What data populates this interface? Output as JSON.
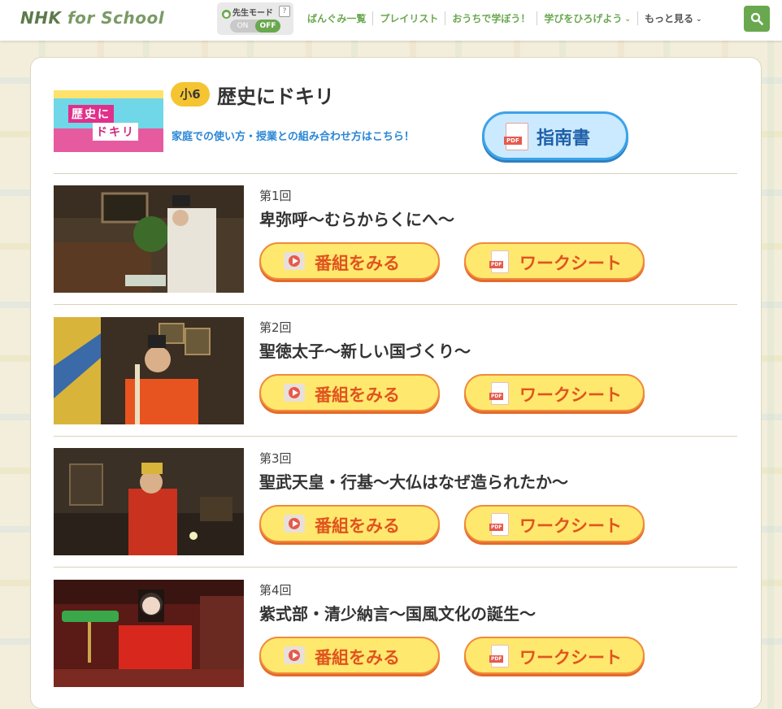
{
  "header": {
    "logo_nhk": "NHK",
    "logo_for": "for School",
    "teacher_mode": {
      "label": "先生モード",
      "help": "?",
      "on": "ON",
      "off": "OFF",
      "state": "OFF"
    },
    "nav": [
      {
        "label": "ばんぐみ一覧"
      },
      {
        "label": "プレイリスト"
      },
      {
        "label": "おうちで学ぼう！"
      },
      {
        "label": "学びをひろげよう"
      },
      {
        "label": "もっと見る"
      }
    ],
    "search_icon": "search-icon"
  },
  "series": {
    "banner_line1": "歴史に",
    "banner_line2": "ドキリ",
    "grade": "小6",
    "title": "歴史にドキリ",
    "guide_link": "家庭での使い方・授業との組み合わせ方はこちら！",
    "guide_button": "指南書",
    "pdf_tag": "PDF"
  },
  "buttons": {
    "watch": "番組をみる",
    "worksheet": "ワークシート",
    "pdf_tag": "PDF"
  },
  "episodes": [
    {
      "number": "第1回",
      "title": "卑弥呼～むらからくにへ～"
    },
    {
      "number": "第2回",
      "title": "聖徳太子～新しい国づくり～"
    },
    {
      "number": "第3回",
      "title": "聖武天皇・行基～大仏はなぜ造られたか～"
    },
    {
      "number": "第4回",
      "title": "紫式部・清少納言～国風文化の誕生～"
    }
  ],
  "colors": {
    "brand_green": "#6aa84f",
    "link_blue": "#2a86d6",
    "button_orange": "#e0541f",
    "button_yellow": "#ffe86e"
  }
}
